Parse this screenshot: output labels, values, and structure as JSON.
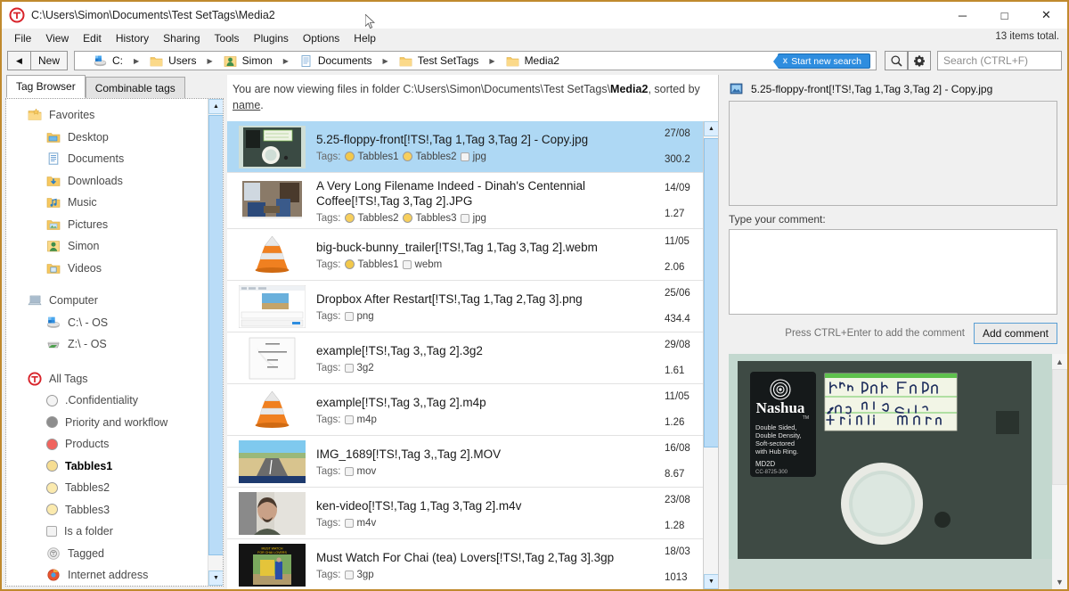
{
  "window": {
    "title": "C:\\Users\\Simon\\Documents\\Test SetTags\\Media2",
    "app_icon": "tabbles-icon",
    "minimize": "─",
    "maximize": "□",
    "close": "✕"
  },
  "menubar": {
    "items": [
      "File",
      "View",
      "Edit",
      "History",
      "Sharing",
      "Tools",
      "Plugins",
      "Options",
      "Help"
    ],
    "items_total": "13 items total."
  },
  "navbar": {
    "back_label": "◀",
    "new_label": "New",
    "breadcrumbs": [
      {
        "label": "C:",
        "icon": "drive-icon"
      },
      {
        "label": "Users",
        "icon": "folder-icon"
      },
      {
        "label": "Simon",
        "icon": "user-folder-icon"
      },
      {
        "label": "Documents",
        "icon": "documents-folder-icon"
      },
      {
        "label": "Test SetTags",
        "icon": "folder-icon"
      },
      {
        "label": "Media2",
        "icon": "folder-icon"
      }
    ],
    "separator": "▶",
    "start_new_search": "Start new search",
    "start_new_search_x": "x",
    "search_icon_btn": "magnifier-icon",
    "settings_icon_btn": "gear-icon",
    "search_placeholder": "Search (CTRL+F)",
    "search_value": ""
  },
  "left_panel": {
    "tabs": [
      {
        "label": "Tag Browser",
        "active": true
      },
      {
        "label": "Combinable tags",
        "active": false
      }
    ],
    "tree": [
      {
        "label": "Favorites",
        "icon": "favorites-folder-icon",
        "level": 1,
        "style": "dim"
      },
      {
        "label": "Desktop",
        "icon": "desktop-folder-icon",
        "level": 2,
        "style": "dim"
      },
      {
        "label": "Documents",
        "icon": "documents-folder-icon",
        "level": 2,
        "style": "dim"
      },
      {
        "label": "Downloads",
        "icon": "downloads-folder-icon",
        "level": 2,
        "style": "dim"
      },
      {
        "label": "Music",
        "icon": "music-folder-icon",
        "level": 2,
        "style": "dim"
      },
      {
        "label": "Pictures",
        "icon": "pictures-folder-icon",
        "level": 2,
        "style": "dim"
      },
      {
        "label": "Simon",
        "icon": "user-folder-icon",
        "level": 2,
        "style": "dim"
      },
      {
        "label": "Videos",
        "icon": "videos-folder-icon",
        "level": 2,
        "style": "dim"
      },
      {
        "label": "Computer",
        "icon": "computer-icon",
        "level": 1,
        "style": "dim",
        "gap_above": true
      },
      {
        "label": "C:\\ - OS",
        "icon": "drive-icon",
        "level": 2,
        "style": "dim"
      },
      {
        "label": "Z:\\ - OS",
        "icon": "network-drive-icon",
        "level": 2,
        "style": "dim"
      },
      {
        "label": "All Tags",
        "icon": "tabbles-icon",
        "level": 1,
        "style": "bold-dim",
        "gap_above": true
      },
      {
        "label": ".Confidentiality",
        "icon": "tag-dot",
        "color": "#f2f2f2",
        "level": 2,
        "style": "dim"
      },
      {
        "label": "Priority and workflow",
        "icon": "tag-dot",
        "color": "#7d7d7d",
        "level": 2,
        "style": "dim"
      },
      {
        "label": "Products",
        "icon": "tag-dot",
        "color": "#f0645e",
        "level": 2,
        "style": "dim"
      },
      {
        "label": "Tabbles1",
        "icon": "tag-dot",
        "color": "#f2d98a",
        "level": 2,
        "style": "bold"
      },
      {
        "label": "Tabbles2",
        "icon": "tag-dot",
        "color": "#f7e7ab",
        "level": 2,
        "style": "dim"
      },
      {
        "label": "Tabbles3",
        "icon": "tag-dot",
        "color": "#f7e7ab",
        "level": 2,
        "style": "dim"
      },
      {
        "label": "Is a folder",
        "icon": "tag-square",
        "color": "#f3f3f3",
        "level": 2,
        "style": "dim"
      },
      {
        "label": "Tagged",
        "icon": "tagged-icon",
        "color": "#ededed",
        "level": 2,
        "style": "dim"
      },
      {
        "label": "Internet address",
        "icon": "internet-icon",
        "color": "#e8542f",
        "level": 2,
        "style": "dim"
      }
    ]
  },
  "center_panel": {
    "viewing_prefix": "You are now viewing files in folder C:\\Users\\Simon\\Documents\\Test SetTags\\",
    "viewing_folder": "Media2",
    "viewing_suffix": ", sorted by ",
    "viewing_sort_link": "name",
    "viewing_end": ".",
    "tags_label": "Tags:",
    "files": [
      {
        "name": "5.25-floppy-front[!TS!,Tag 1,Tag 3,Tag 2] - Copy.jpg",
        "thumb": "floppy-disk-photo",
        "tags": [
          {
            "label": "Tabbles1",
            "shape": "dot",
            "color": "#f2c84b"
          },
          {
            "label": "Tabbles2",
            "shape": "dot",
            "color": "#f7cf5d"
          },
          {
            "label": "jpg",
            "shape": "square",
            "color": "#f3f3f3"
          }
        ],
        "date": "27/08",
        "size": "300.2",
        "selected": true
      },
      {
        "name": "A Very Long Filename Indeed - Dinah's Centennial Coffee[!TS!,Tag 3,Tag 2].JPG",
        "thumb": "coffee-shop-photo",
        "tags": [
          {
            "label": "Tabbles2",
            "shape": "dot",
            "color": "#f7cf5d"
          },
          {
            "label": "Tabbles3",
            "shape": "dot",
            "color": "#f7cf5d"
          },
          {
            "label": "jpg",
            "shape": "square",
            "color": "#f3f3f3"
          }
        ],
        "date": "14/09",
        "size": "1.27 ",
        "selected": false
      },
      {
        "name": "big-buck-bunny_trailer[!TS!,Tag 1,Tag 3,Tag 2].webm",
        "thumb": "vlc-cone-icon",
        "tags": [
          {
            "label": "Tabbles1",
            "shape": "dot",
            "color": "#f2c84b"
          },
          {
            "label": "webm",
            "shape": "square",
            "color": "#f3f3f3"
          }
        ],
        "date": "11/05",
        "size": "2.06 ",
        "selected": false
      },
      {
        "name": "Dropbox After Restart[!TS!,Tag 1,Tag 2,Tag 3].png",
        "thumb": "dropbox-screenshot",
        "tags": [
          {
            "label": "png",
            "shape": "square",
            "color": "#f3f3f3"
          }
        ],
        "date": "25/06",
        "size": "434.4",
        "selected": false
      },
      {
        "name": "example[!TS!,Tag 3,,Tag 2].3g2",
        "thumb": "document-page-thumb",
        "tags": [
          {
            "label": "3g2",
            "shape": "square",
            "color": "#f3f3f3"
          }
        ],
        "date": "29/08",
        "size": "1.61 ",
        "selected": false
      },
      {
        "name": "example[!TS!,Tag 3,,Tag 2].m4p",
        "thumb": "vlc-cone-icon",
        "tags": [
          {
            "label": "m4p",
            "shape": "square",
            "color": "#f3f3f3"
          }
        ],
        "date": "11/05",
        "size": "1.26 ",
        "selected": false
      },
      {
        "name": "IMG_1689[!TS!,Tag 3,,Tag 2].MOV",
        "thumb": "road-photo",
        "tags": [
          {
            "label": "mov",
            "shape": "square",
            "color": "#f3f3f3"
          }
        ],
        "date": "16/08",
        "size": "8.67 ",
        "selected": false
      },
      {
        "name": "ken-video[!TS!,Tag 1,Tag 3,Tag 2].m4v",
        "thumb": "man-video-thumb",
        "tags": [
          {
            "label": "m4v",
            "shape": "square",
            "color": "#f3f3f3"
          }
        ],
        "date": "23/08",
        "size": "1.28 ",
        "selected": false
      },
      {
        "name": "Must Watch For Chai (tea) Lovers[!TS!,Tag 2,Tag 3].3gp",
        "thumb": "chai-video-thumb",
        "tags": [
          {
            "label": "3gp",
            "shape": "square",
            "color": "#f3f3f3"
          }
        ],
        "date": "18/03",
        "size": "1013",
        "selected": false
      }
    ]
  },
  "right_panel": {
    "file_title": "5.25-floppy-front[!TS!,Tag 1,Tag 3,Tag 2] - Copy.jpg",
    "file_icon": "image-file-icon",
    "comments_value": "",
    "comment_label": "Type your comment:",
    "comment_value": "",
    "hint": "Press CTRL+Enter to add the comment",
    "add_comment_label": "Add comment",
    "preview_image": "nashua-floppy-disk-photo",
    "preview_alt_lines": [
      "Borland Turbo Prolog",
      "sample Programs",
      "Utilities  master"
    ],
    "preview_brand": "Nashua",
    "preview_brand_tm": "™",
    "preview_spec": "Double Sided,\nDouble Density,\nSoft-sectored\nwith Hub Ring.",
    "preview_model": "MD2D",
    "preview_code": "CC-8725-300"
  },
  "colors": {
    "window_border": "#c08a2e",
    "selection": "#aed8f4",
    "accent_blue": "#2e8ddf",
    "tag_yellow": "#f2c84b",
    "tag_red": "#f0645e",
    "tabbles_red": "#d8232a"
  }
}
